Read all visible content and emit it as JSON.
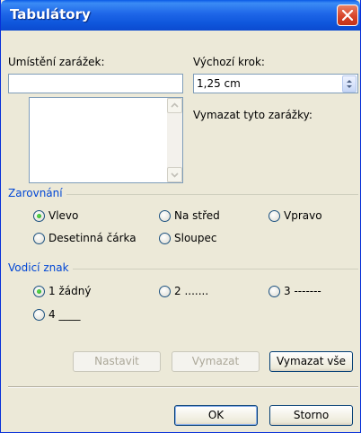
{
  "window": {
    "title": "Tabulátory"
  },
  "positions": {
    "label": "Umístění zarážek:",
    "input_value": "",
    "list_items": []
  },
  "default_step": {
    "label": "Výchozí krok:",
    "value": "1,25 cm"
  },
  "clear_label": "Vymazat tyto zarážky:",
  "alignment": {
    "title": "Zarovnání",
    "options": [
      {
        "label": "Vlevo",
        "checked": true
      },
      {
        "label": "Na střed",
        "checked": false
      },
      {
        "label": "Vpravo",
        "checked": false
      },
      {
        "label": "Desetinná čárka",
        "checked": false
      },
      {
        "label": "Sloupec",
        "checked": false
      }
    ]
  },
  "leader": {
    "title": "Vodicí znak",
    "options": [
      {
        "label": "1 žádný",
        "checked": true
      },
      {
        "label": "2 .......",
        "checked": false
      },
      {
        "label": "3 -------",
        "checked": false
      },
      {
        "label": "4 ____",
        "checked": false
      }
    ]
  },
  "buttons": {
    "set": "Nastavit",
    "clear": "Vymazat",
    "clear_all": "Vymazat vše",
    "ok": "OK",
    "cancel": "Storno"
  },
  "colors": {
    "title_bar": "#0f57dc",
    "group_title": "#0046d5",
    "radio_selected": "#21a121",
    "close_button": "#d8452a"
  }
}
